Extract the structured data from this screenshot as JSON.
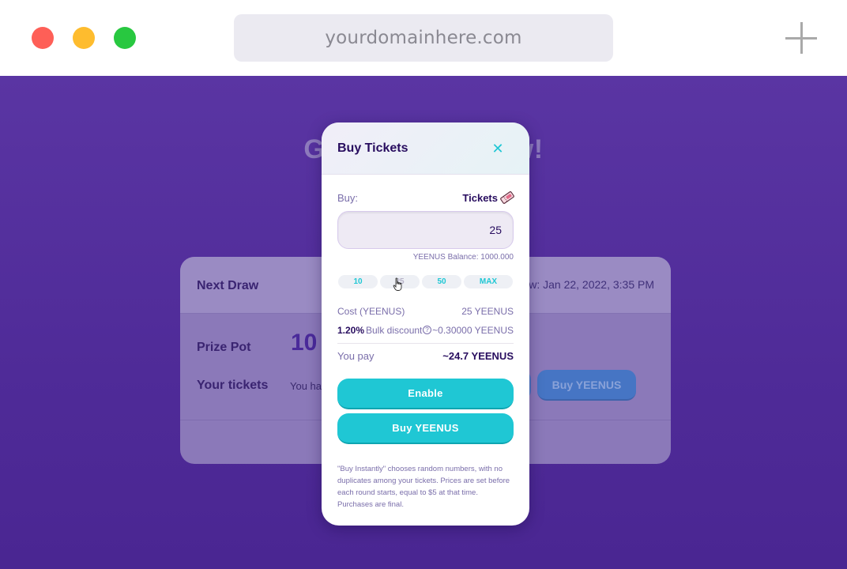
{
  "browser": {
    "url": "yourdomainhere.com"
  },
  "background": {
    "heading_left": "Ge",
    "heading_right": "w!",
    "card": {
      "next_draw_label": "Next Draw",
      "draw_time": "aw: Jan 22, 2022, 3:35 PM",
      "prize_pot_label": "Prize Pot",
      "prize_pot_value": "10",
      "your_tickets_label": "Your tickets",
      "your_tickets_text": "You ha",
      "buy_button": "Buy YEENUS"
    }
  },
  "modal": {
    "title": "Buy Tickets",
    "close_icon": "close-icon",
    "buy_label": "Buy:",
    "currency_label": "Tickets",
    "ticket_icon": "ticket-icon",
    "quantity": "25",
    "balance": "YEENUS Balance: 1000.000",
    "quick_amounts": [
      "10",
      "25",
      "50",
      "MAX"
    ],
    "cost_label": "Cost (YEENUS)",
    "cost_value": "25 YEENUS",
    "discount_pct": "1.20%",
    "discount_label": "Bulk discount",
    "discount_value": "~0.30000 YEENUS",
    "you_pay_label": "You pay",
    "you_pay_value": "~24.7 YEENUS",
    "enable_button": "Enable",
    "buy_button": "Buy YEENUS",
    "footnote": "\"Buy Instantly\" chooses random numbers, with no duplicates among your tickets. Prices are set before each round starts, equal to $5 at that time. Purchases are final."
  },
  "colors": {
    "accent": "#1fc7d4",
    "text_primary": "#280d5f",
    "text_secondary": "#7a6eaa",
    "page_bg": "#5a35a3"
  }
}
